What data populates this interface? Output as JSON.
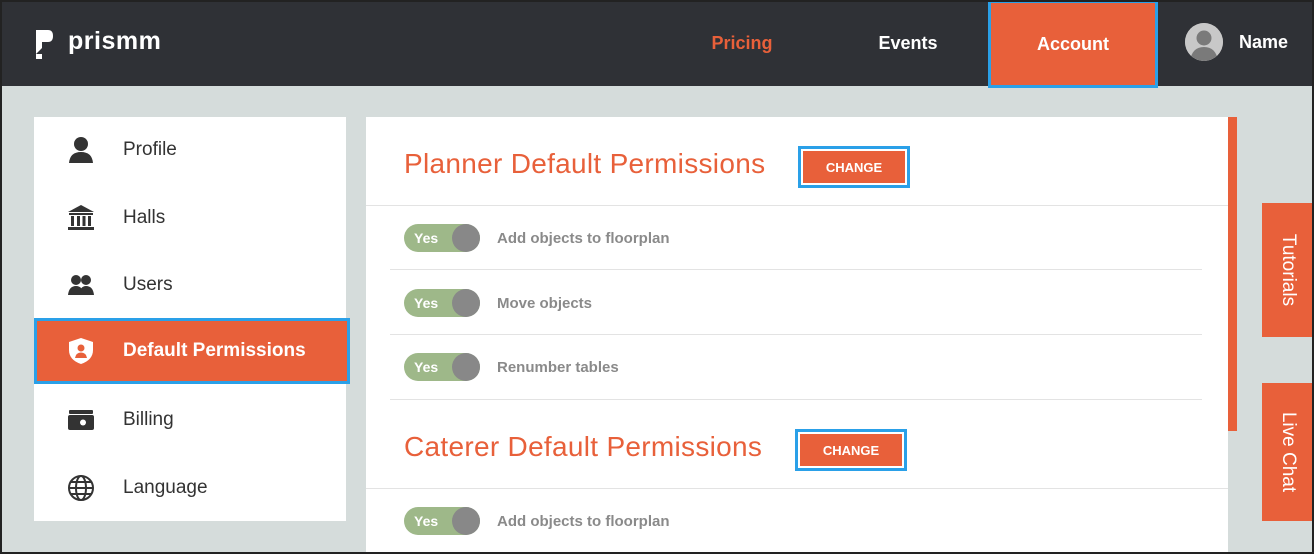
{
  "brand": {
    "name": "prismm"
  },
  "nav": {
    "pricing": "Pricing",
    "events": "Events",
    "account": "Account",
    "user_name": "Name"
  },
  "colors": {
    "accent": "#e8603a",
    "topbar": "#2f3136",
    "toggle_on": "#9eb889",
    "highlight": "#2aa0e8"
  },
  "sidebar": {
    "items": [
      {
        "label": "Profile",
        "icon": "user-icon"
      },
      {
        "label": "Halls",
        "icon": "building-icon"
      },
      {
        "label": "Users",
        "icon": "users-icon"
      },
      {
        "label": "Default Permissions",
        "icon": "shield-user-icon",
        "active": true
      },
      {
        "label": "Billing",
        "icon": "wallet-icon"
      },
      {
        "label": "Language",
        "icon": "globe-icon"
      }
    ]
  },
  "main": {
    "sections": [
      {
        "title": "Planner Default Permissions",
        "button": "CHANGE",
        "permissions": [
          {
            "toggle": "Yes",
            "label": "Add objects to floorplan"
          },
          {
            "toggle": "Yes",
            "label": "Move objects"
          },
          {
            "toggle": "Yes",
            "label": "Renumber tables"
          }
        ]
      },
      {
        "title": "Caterer Default Permissions",
        "button": "CHANGE",
        "permissions": [
          {
            "toggle": "Yes",
            "label": "Add objects to floorplan"
          }
        ]
      }
    ]
  },
  "side_tabs": {
    "tutorials": "Tutorials",
    "live_chat": "Live Chat"
  }
}
